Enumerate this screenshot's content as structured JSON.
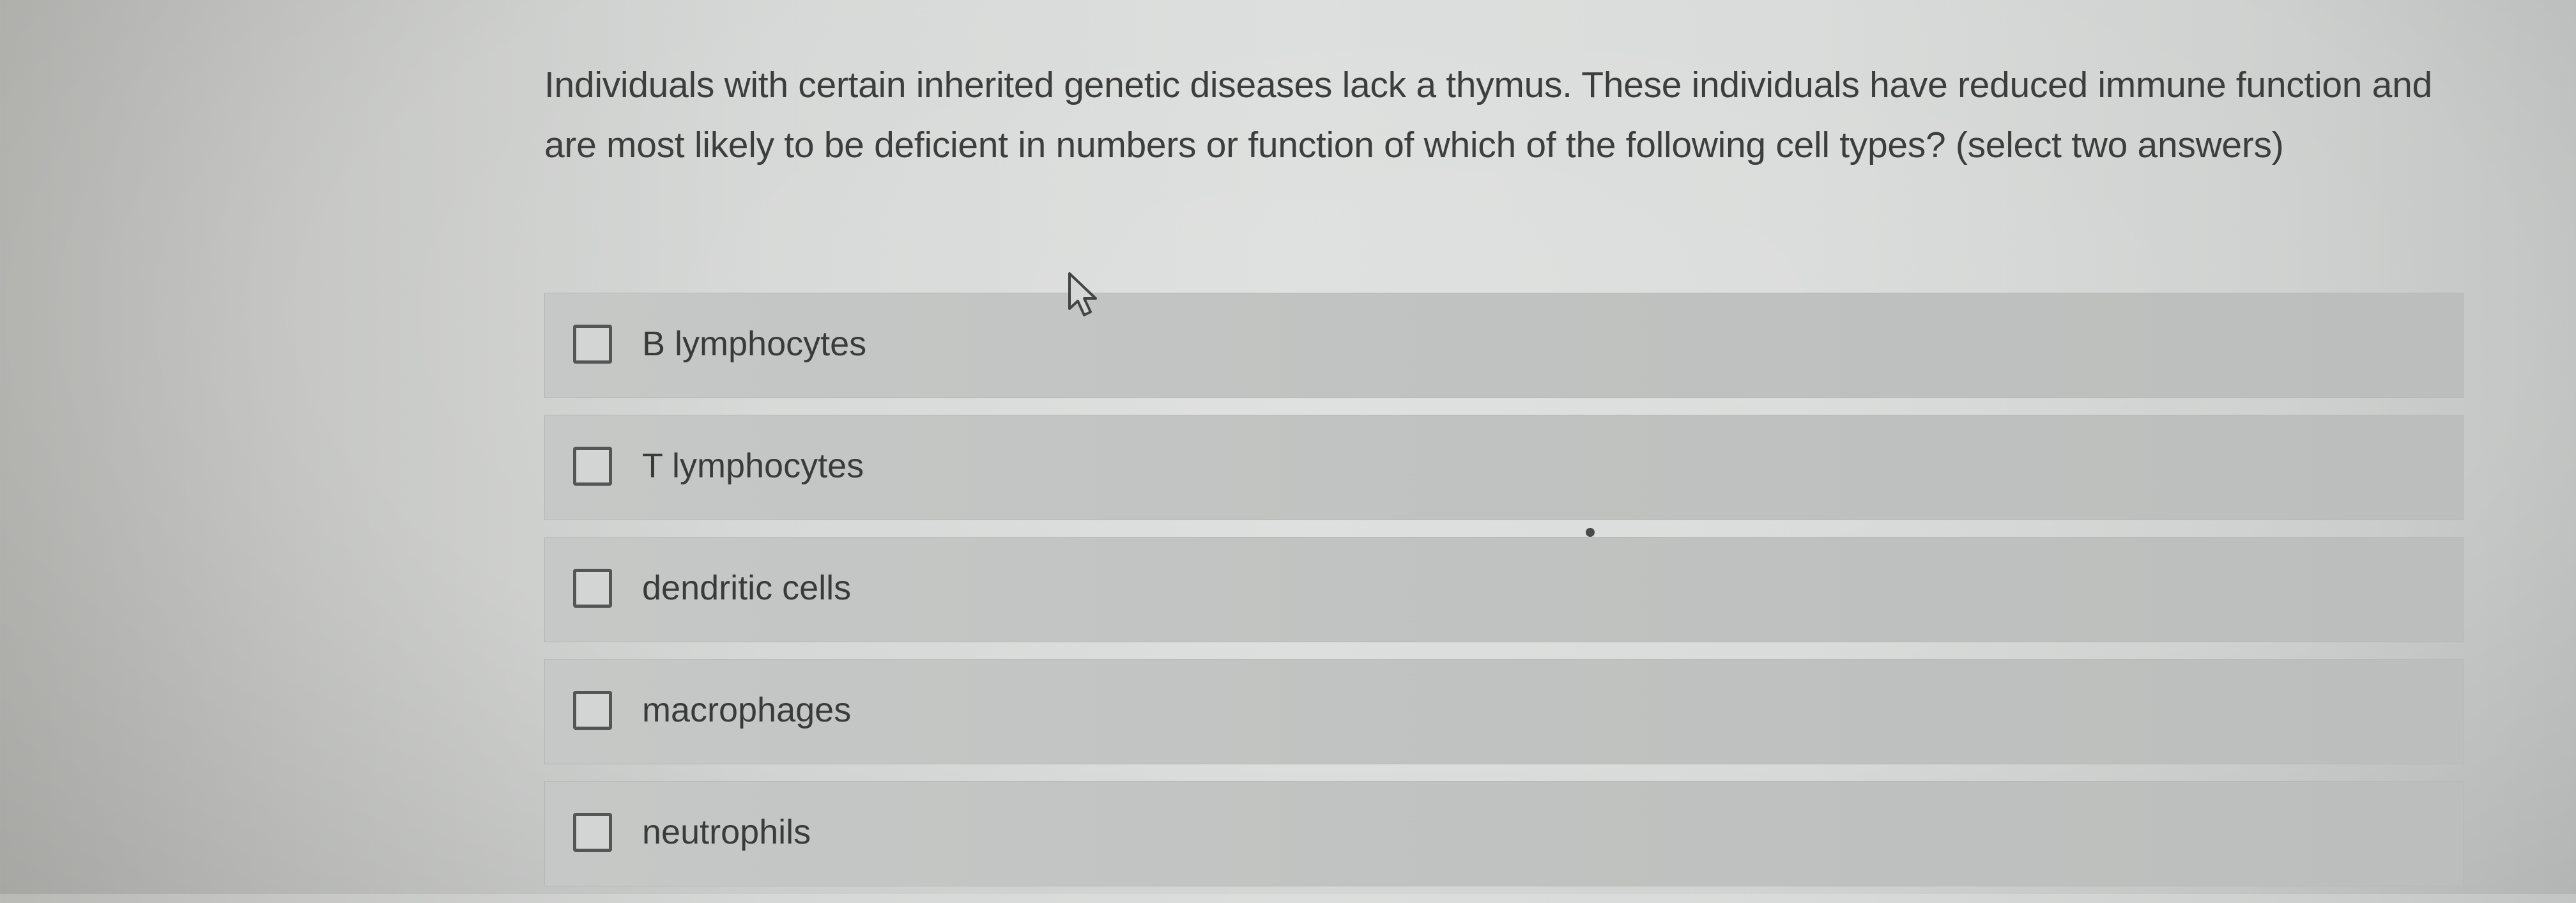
{
  "question": {
    "text": "Individuals with certain inherited genetic diseases lack a thymus. These individuals have reduced immune function and are most likely to be deficient in numbers or function of which of the following cell types? (select two answers)"
  },
  "options": [
    {
      "label": "B lymphocytes",
      "checked": false
    },
    {
      "label": "T lymphocytes",
      "checked": false
    },
    {
      "label": "dendritic cells",
      "checked": false
    },
    {
      "label": "macrophages",
      "checked": false
    },
    {
      "label": "neutrophils",
      "checked": false
    }
  ],
  "cursor": {
    "icon": "mouse-pointer-icon"
  },
  "colors": {
    "text": "#3d3d3d",
    "option_background": "#c3c5c4",
    "checkbox_border": "#555555"
  }
}
